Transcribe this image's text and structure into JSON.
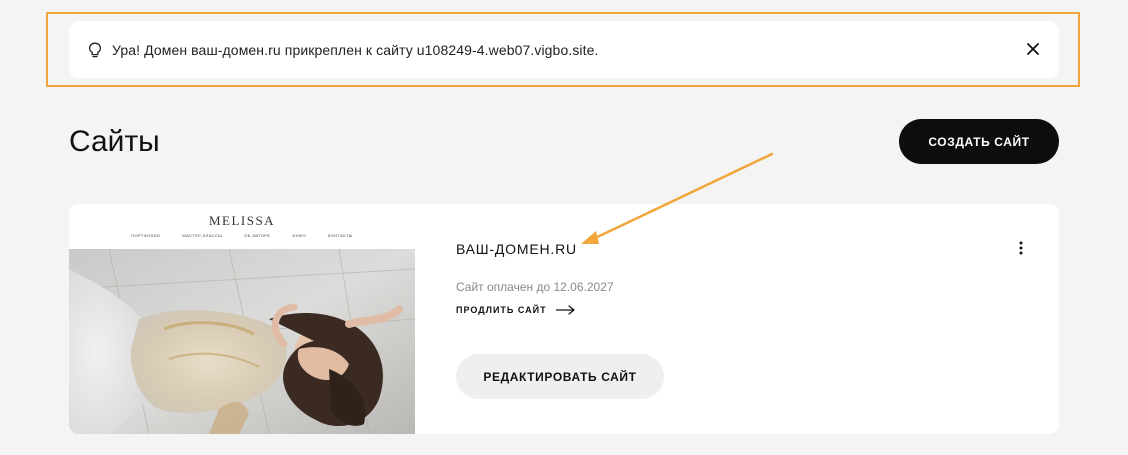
{
  "notification": {
    "text": "Ура! Домен ваш-домен.ru прикреплен к сайту u108249-4.web07.vigbo.site.",
    "info_icon": "lightbulb-icon",
    "close_icon": "close-icon"
  },
  "page": {
    "title": "Сайты"
  },
  "toolbar": {
    "create_label": "СОЗДАТЬ САЙТ"
  },
  "site_card": {
    "preview": {
      "logo": "MELISSA",
      "nav": [
        "ПОРТФОЛИО",
        "МАСТЕР-КЛАССЫ",
        "ОБ АВТОРЕ",
        "ИНФО",
        "КОНТАКТЫ"
      ]
    },
    "name": "ВАШ-ДОМЕН.RU",
    "paid_status": "Сайт оплачен до 12.06.2027",
    "extend_label": "ПРОДЛИТЬ САЙТ",
    "extend_icon": "arrow-right-icon",
    "menu_icon": "kebab-menu-icon",
    "edit_label": "РЕДАКТИРОВАТЬ САЙТ"
  },
  "colors": {
    "background": "#f4f4f4",
    "card": "#ffffff",
    "primary_button": "#0d0d0d",
    "secondary_button": "#efefef",
    "annotation": "#f0a63a",
    "muted_text": "#8a8a8a"
  }
}
